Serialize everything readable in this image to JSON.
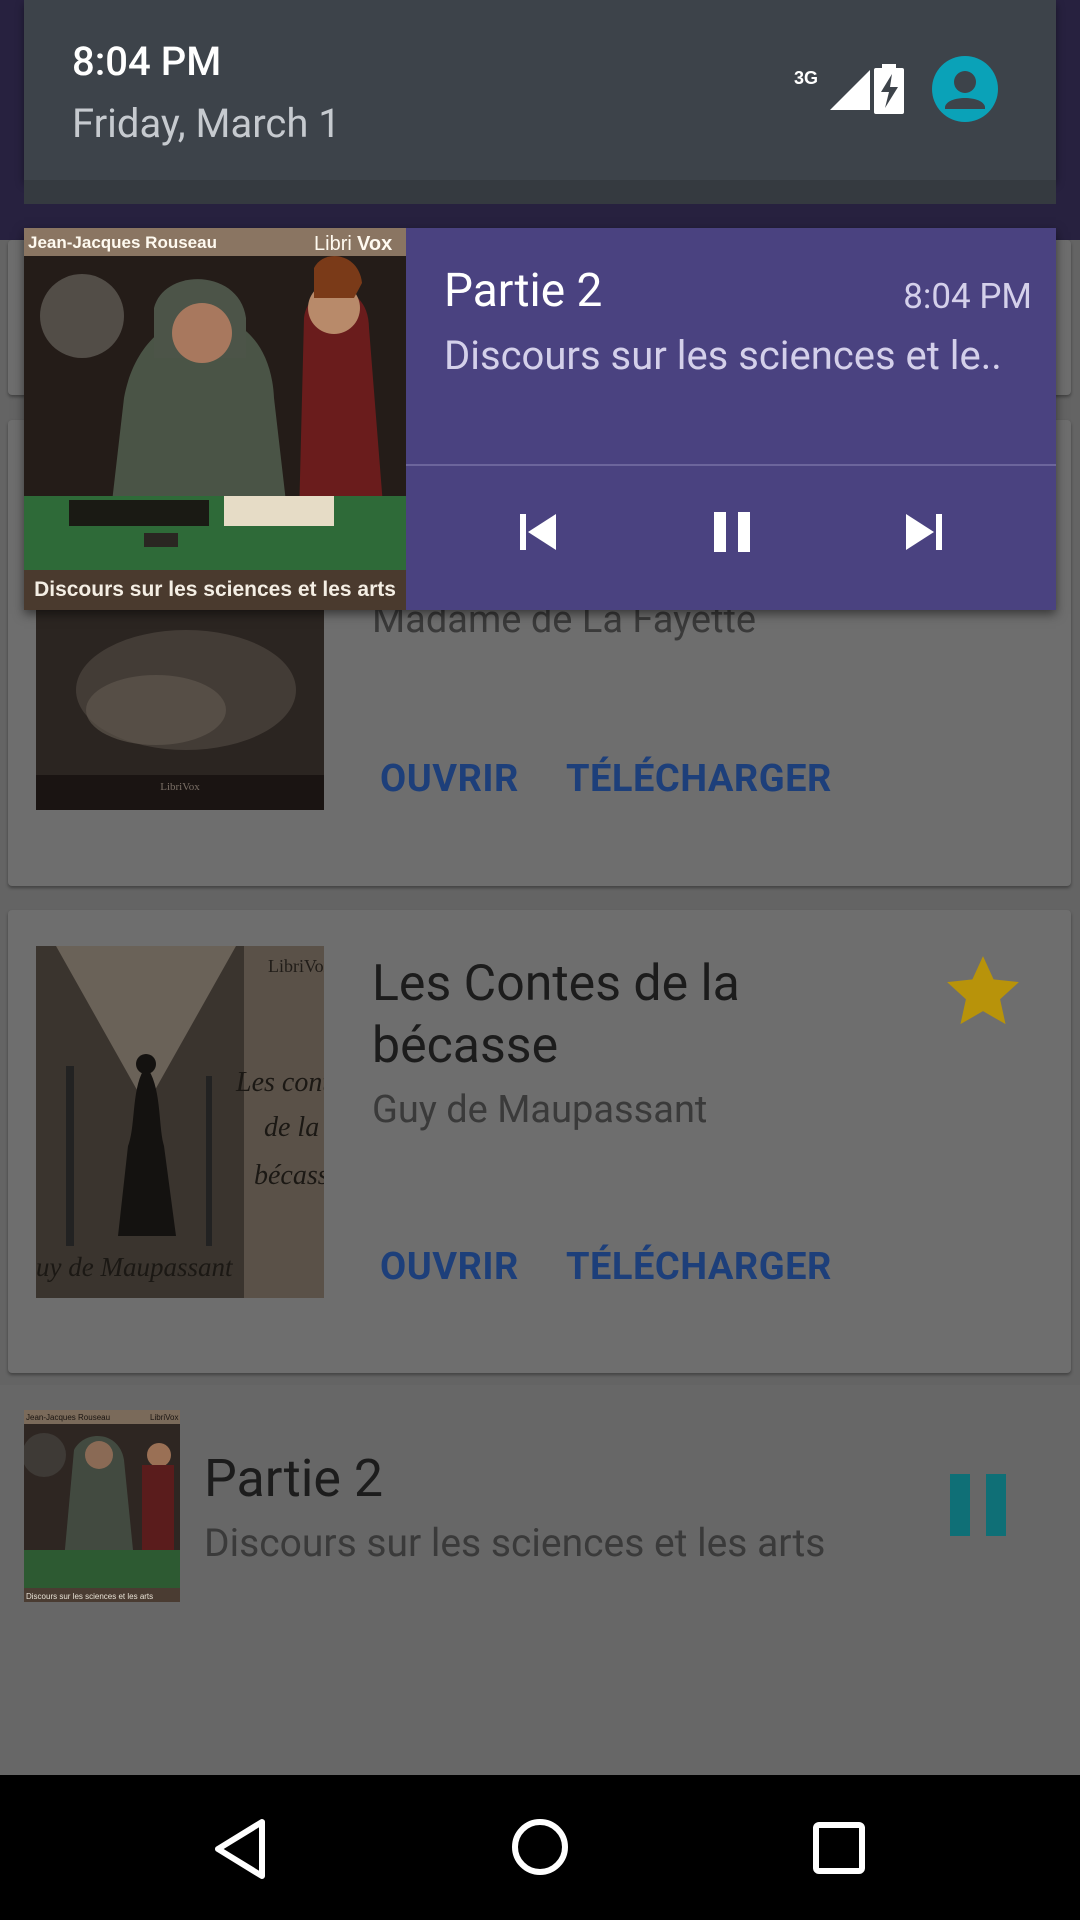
{
  "status": {
    "time": "8:04 PM",
    "date": "Friday, March 1",
    "network": "3G"
  },
  "notification": {
    "title": "Partie 2",
    "time": "8:04 PM",
    "subtitle": "Discours sur les sciences et le..",
    "art": {
      "author": "Jean-Jacques Rouseau",
      "brand_a": "Libri",
      "brand_b": "Vox",
      "caption": "Discours sur les sciences et les arts"
    }
  },
  "books": [
    {
      "author": "Madame de La Fayette",
      "cover_brand": "LibriVox",
      "open_label": "OUVRIR",
      "download_label": "TÉLÉCHARGER"
    },
    {
      "title_line1": "Les Contes de la",
      "title_line2": "bécasse",
      "author": "Guy de Maupassant",
      "cover_brand": "LibriVox",
      "cover_lines": [
        "Les cont",
        "de la",
        "bécass"
      ],
      "cover_author": "uy de Maupassant",
      "open_label": "OUVRIR",
      "download_label": "TÉLÉCHARGER",
      "favorite": true
    }
  ],
  "mini_player": {
    "title": "Partie 2",
    "subtitle": "Discours sur les sciences et les arts",
    "art_author": "Jean-Jacques Rouseau",
    "art_brand": "LibriVox",
    "art_caption": "Discours sur les sciences et les arts"
  },
  "colors": {
    "notification_bg": "#4a4280",
    "accent_link": "#1d3f7a",
    "star": "#b8930a",
    "pause_teal": "#0f6f76",
    "avatar": "#0aa2b8"
  }
}
